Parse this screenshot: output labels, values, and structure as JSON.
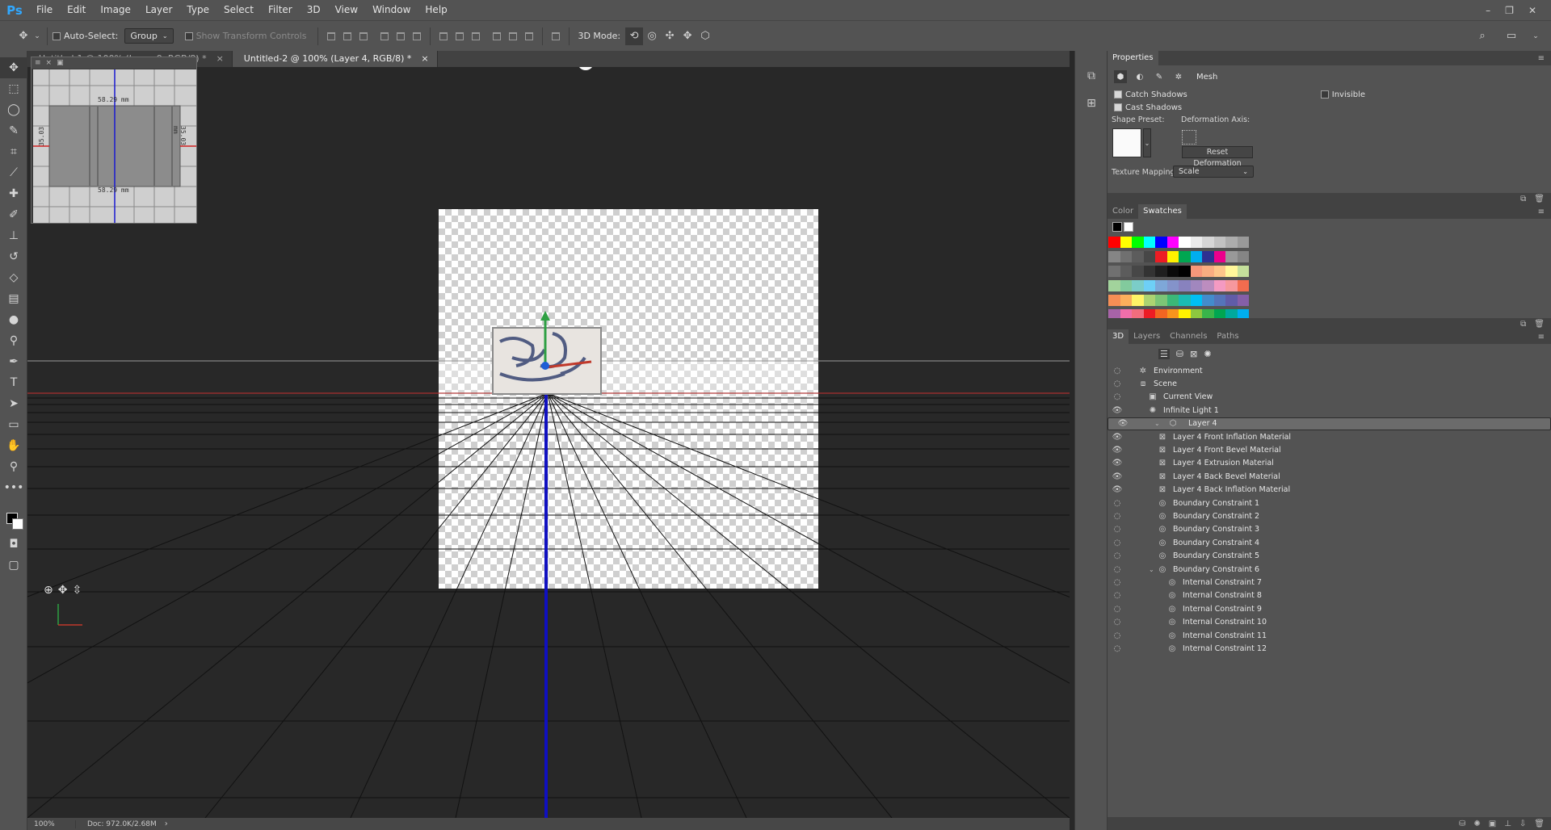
{
  "app": {
    "logo": "Ps"
  },
  "menu": [
    "File",
    "Edit",
    "Image",
    "Layer",
    "Type",
    "Select",
    "Filter",
    "3D",
    "View",
    "Window",
    "Help"
  ],
  "window_controls": [
    "–",
    "❐",
    "✕"
  ],
  "options": {
    "auto_select_label": "Auto-Select:",
    "auto_select_value": "Group",
    "show_transform_label": "Show Transform Controls",
    "mode_label": "3D Mode:"
  },
  "tabs": [
    {
      "label": "Untitled-1 @ 100% (Layer 9, RGB/8) *",
      "close": "×"
    },
    {
      "label": "Untitled-2 @ 100% (Layer 4, RGB/8) *",
      "close": "×"
    }
  ],
  "miniview": {
    "dim_top": "58.29 mm",
    "dim_bottom": "58.29 mm",
    "dim_left": "35.03",
    "dim_right": "35.03 mm"
  },
  "status": {
    "zoom": "100%",
    "doc": "Doc: 972.0K/2.68M"
  },
  "properties": {
    "title": "Properties",
    "section": "Mesh",
    "catch_shadows": "Catch Shadows",
    "cast_shadows": "Cast Shadows",
    "invisible": "Invisible",
    "shape_preset_label": "Shape Preset:",
    "deformation_axis_label": "Deformation Axis:",
    "reset_deformation": "Reset Deformation",
    "texture_mapping_label": "Texture Mapping:",
    "texture_mapping_value": "Scale"
  },
  "swatch_tabs": [
    "Color",
    "Swatches"
  ],
  "swatch_colors": [
    "#ff0000",
    "#ffff00",
    "#00ff00",
    "#00ffff",
    "#0000ff",
    "#ff00ff",
    "#ffffff",
    "#ebebeb",
    "#d6d6d6",
    "#c2c2c2",
    "#adadad",
    "#999999",
    "#858585",
    "#707070",
    "#5c5c5c",
    "#474747",
    "#ed1c24",
    "#fff200",
    "#00a651",
    "#00aeef",
    "#2e3192",
    "#ec008c",
    "#999999",
    "#858585",
    "#707070",
    "#5c5c5c",
    "#474747",
    "#333333",
    "#1f1f1f",
    "#0a0a0a",
    "#000000",
    "#f7977a",
    "#f9ad81",
    "#fdc68a",
    "#fff79a",
    "#c4df9b",
    "#a2d39c",
    "#82ca9d",
    "#7bcdc8",
    "#6ecff6",
    "#7ea7d8",
    "#8493ca",
    "#8882be",
    "#a187be",
    "#bc8dbf",
    "#f49ac2",
    "#f6989d",
    "#f26c4f",
    "#f68e55",
    "#fbaf5c",
    "#fff467",
    "#acd372",
    "#7cc576",
    "#3bb878",
    "#1abbb4",
    "#00bff3",
    "#438ccb",
    "#5574b9",
    "#605ca8",
    "#855fa8",
    "#a763a8",
    "#f06ea9",
    "#f26d7d",
    "#ed1c24",
    "#f26522",
    "#f7941d",
    "#fff200",
    "#8dc73f",
    "#39b54a",
    "#00a651",
    "#00a99d",
    "#00aeef",
    "#0072bc",
    "#0054a6",
    "#2e3192",
    "#662d91",
    "#92278f",
    "#ec008c",
    "#ed145b",
    "#9e0b0f",
    "#a0410d",
    "#a3620a",
    "#aba000",
    "#598527"
  ],
  "layer_tabs": [
    "3D",
    "Layers",
    "Channels",
    "Paths"
  ],
  "layers3d": [
    {
      "label": "Environment",
      "indent": 0,
      "icon": "✲",
      "eye": "◌",
      "twirl": "",
      "selected": false
    },
    {
      "label": "Scene",
      "indent": 0,
      "icon": "⧈",
      "eye": "◌",
      "twirl": "",
      "selected": false
    },
    {
      "label": "Current View",
      "indent": 1,
      "icon": "▣",
      "eye": "◌",
      "twirl": "",
      "selected": false
    },
    {
      "label": "Infinite Light 1",
      "indent": 1,
      "icon": "✺",
      "eye": "👁",
      "twirl": "",
      "selected": false
    },
    {
      "label": "Layer 4",
      "indent": 1,
      "icon": "⬡",
      "eye": "👁",
      "twirl": "⌄",
      "selected": true
    },
    {
      "label": "Layer 4 Front Inflation Material",
      "indent": 2,
      "icon": "⊠",
      "eye": "👁",
      "twirl": "",
      "selected": false
    },
    {
      "label": "Layer 4 Front Bevel Material",
      "indent": 2,
      "icon": "⊠",
      "eye": "👁",
      "twirl": "",
      "selected": false
    },
    {
      "label": "Layer 4 Extrusion Material",
      "indent": 2,
      "icon": "⊠",
      "eye": "👁",
      "twirl": "",
      "selected": false
    },
    {
      "label": "Layer 4 Back Bevel Material",
      "indent": 2,
      "icon": "⊠",
      "eye": "👁",
      "twirl": "",
      "selected": false
    },
    {
      "label": "Layer 4 Back Inflation Material",
      "indent": 2,
      "icon": "⊠",
      "eye": "👁",
      "twirl": "",
      "selected": false
    },
    {
      "label": "Boundary Constraint 1",
      "indent": 2,
      "icon": "◎",
      "eye": "◌",
      "twirl": "",
      "selected": false
    },
    {
      "label": "Boundary Constraint 2",
      "indent": 2,
      "icon": "◎",
      "eye": "◌",
      "twirl": "",
      "selected": false
    },
    {
      "label": "Boundary Constraint 3",
      "indent": 2,
      "icon": "◎",
      "eye": "◌",
      "twirl": "",
      "selected": false
    },
    {
      "label": "Boundary Constraint 4",
      "indent": 2,
      "icon": "◎",
      "eye": "◌",
      "twirl": "",
      "selected": false
    },
    {
      "label": "Boundary Constraint 5",
      "indent": 2,
      "icon": "◎",
      "eye": "◌",
      "twirl": "",
      "selected": false
    },
    {
      "label": "Boundary Constraint 6",
      "indent": 2,
      "icon": "◎",
      "eye": "◌",
      "twirl": "⌄",
      "selected": false
    },
    {
      "label": "Internal Constraint 7",
      "indent": 3,
      "icon": "◎",
      "eye": "◌",
      "twirl": "",
      "selected": false
    },
    {
      "label": "Internal Constraint 8",
      "indent": 3,
      "icon": "◎",
      "eye": "◌",
      "twirl": "",
      "selected": false
    },
    {
      "label": "Internal Constraint 9",
      "indent": 3,
      "icon": "◎",
      "eye": "◌",
      "twirl": "",
      "selected": false
    },
    {
      "label": "Internal Constraint 10",
      "indent": 3,
      "icon": "◎",
      "eye": "◌",
      "twirl": "",
      "selected": false
    },
    {
      "label": "Internal Constraint 11",
      "indent": 3,
      "icon": "◎",
      "eye": "◌",
      "twirl": "",
      "selected": false
    },
    {
      "label": "Internal Constraint 12",
      "indent": 3,
      "icon": "◎",
      "eye": "◌",
      "twirl": "",
      "selected": false
    }
  ]
}
